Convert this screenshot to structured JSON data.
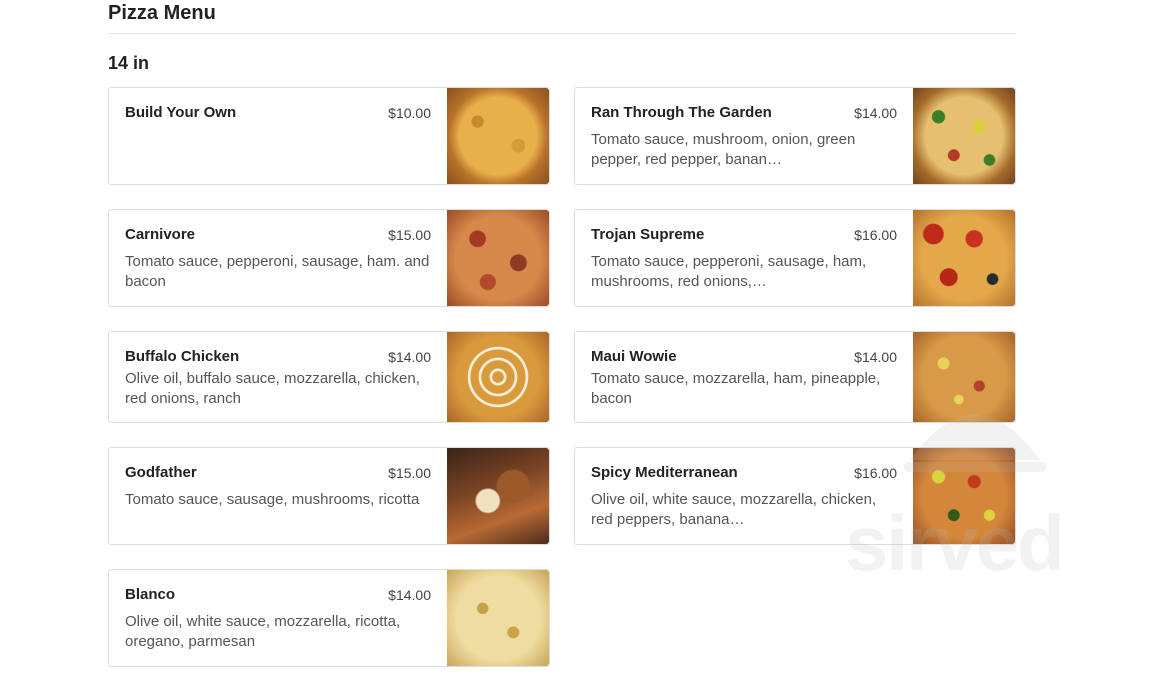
{
  "page": {
    "title": "Pizza Menu"
  },
  "section": {
    "title": "14 in"
  },
  "items": [
    {
      "name": "Build Your Own",
      "price": "$10.00",
      "desc": ""
    },
    {
      "name": "Ran Through The Garden",
      "price": "$14.00",
      "desc": "Tomato sauce, mushroom, onion, green pepper, red pepper, banan…"
    },
    {
      "name": "Carnivore",
      "price": "$15.00",
      "desc": "Tomato sauce, pepperoni, sausage, ham. and bacon"
    },
    {
      "name": "Trojan Supreme",
      "price": "$16.00",
      "desc": "Tomato sauce, pepperoni, sausage, ham, mushrooms, red onions,…"
    },
    {
      "name": "Buffalo Chicken",
      "price": "$14.00",
      "desc": "Olive oil, buffalo sauce, mozzarella, chicken, red onions, ranch"
    },
    {
      "name": "Maui Wowie",
      "price": "$14.00",
      "desc": "Tomato sauce, mozzarella, ham, pineapple, bacon"
    },
    {
      "name": "Godfather",
      "price": "$15.00",
      "desc": "Tomato sauce, sausage, mushrooms, ricotta"
    },
    {
      "name": "Spicy Mediterranean",
      "price": "$16.00",
      "desc": "Olive oil, white sauce, mozzarella, chicken, red peppers, banana…"
    },
    {
      "name": "Blanco",
      "price": "$14.00",
      "desc": "Olive oil, white sauce, mozzarella, ricotta, oregano, parmesan"
    }
  ],
  "watermark": {
    "text": "sirved"
  },
  "colors": {
    "card_border": "#dcdcdc",
    "heading": "#222222",
    "description": "#555555"
  }
}
